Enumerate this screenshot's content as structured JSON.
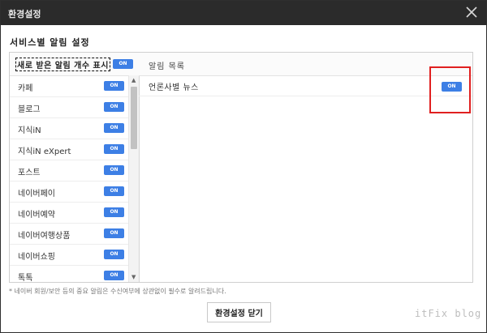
{
  "window": {
    "title": "환경설정",
    "close_icon": "close-x"
  },
  "section": {
    "heading": "서비스별 알림 설정"
  },
  "left": {
    "master_label": "새로 받은 알림 개수 표시",
    "master_toggle": "ON",
    "items": [
      {
        "label": "카페",
        "toggle": "ON"
      },
      {
        "label": "블로그",
        "toggle": "ON"
      },
      {
        "label": "지식iN",
        "toggle": "ON"
      },
      {
        "label": "지식iN eXpert",
        "toggle": "ON"
      },
      {
        "label": "포스트",
        "toggle": "ON"
      },
      {
        "label": "네이버페이",
        "toggle": "ON"
      },
      {
        "label": "네이버예약",
        "toggle": "ON"
      },
      {
        "label": "네이버여행상품",
        "toggle": "ON"
      },
      {
        "label": "네이버쇼핑",
        "toggle": "ON"
      },
      {
        "label": "톡톡",
        "toggle": "ON"
      }
    ]
  },
  "right": {
    "title": "알림 목록",
    "items": [
      {
        "label": "언론사별 뉴스",
        "toggle": "ON"
      }
    ]
  },
  "footer": {
    "note": "* 네이버 회원/보안 등의 중요 알림은 수신여부에 상관없이 필수로 알려드립니다.",
    "close_button": "환경설정 닫기"
  },
  "watermark": "itFix blog",
  "colors": {
    "toggle_on": "#3d7fe5",
    "titlebar": "#2b2b2b",
    "highlight": "#e02020"
  }
}
